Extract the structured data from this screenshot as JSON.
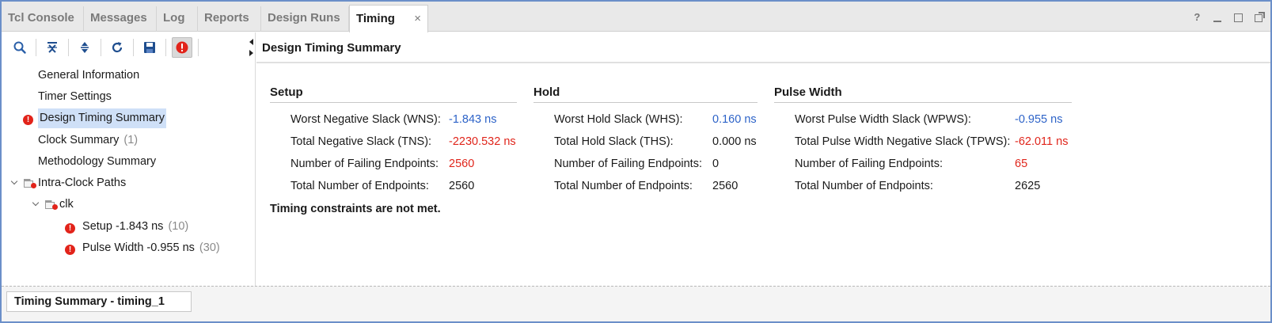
{
  "tabs": [
    {
      "label": "Tcl Console",
      "active": false
    },
    {
      "label": "Messages",
      "active": false
    },
    {
      "label": "Log",
      "active": false
    },
    {
      "label": "Reports",
      "active": false
    },
    {
      "label": "Design Runs",
      "active": false
    },
    {
      "label": "Timing",
      "active": true,
      "close": "×"
    }
  ],
  "window_controls": {
    "help": "?"
  },
  "toolbar": {
    "buttons": [
      "search-icon",
      "collapse-all-icon",
      "expand-all-icon",
      "refresh-icon",
      "save-icon",
      "error-filter-icon"
    ]
  },
  "tree": {
    "items": [
      {
        "label": "General Information"
      },
      {
        "label": "Timer Settings"
      },
      {
        "label": "Design Timing Summary",
        "selected": true,
        "status": "error"
      },
      {
        "label": "Clock Summary",
        "count": "(1)"
      },
      {
        "label": "Methodology Summary"
      },
      {
        "label": "Intra-Clock Paths",
        "expanded": true
      },
      {
        "label": "clk",
        "expanded": true
      },
      {
        "label": "Setup -1.843 ns",
        "count": "(10)",
        "status": "error"
      },
      {
        "label": "Pulse Width -0.955 ns",
        "count": "(30)",
        "status": "error"
      }
    ]
  },
  "main": {
    "title": "Design Timing Summary",
    "setup": {
      "title": "Setup",
      "rows": [
        {
          "label": "Worst Negative Slack (WNS):",
          "value": "-1.843 ns",
          "color": "blue"
        },
        {
          "label": "Total Negative Slack (TNS):",
          "value": "-2230.532 ns",
          "color": "red"
        },
        {
          "label": "Number of Failing Endpoints:",
          "value": "2560",
          "color": "red"
        },
        {
          "label": "Total Number of Endpoints:",
          "value": "2560",
          "color": "black"
        }
      ]
    },
    "hold": {
      "title": "Hold",
      "rows": [
        {
          "label": "Worst Hold Slack (WHS):",
          "value": "0.160 ns",
          "color": "blue"
        },
        {
          "label": "Total Hold Slack (THS):",
          "value": "0.000 ns",
          "color": "black"
        },
        {
          "label": "Number of Failing Endpoints:",
          "value": "0",
          "color": "black"
        },
        {
          "label": "Total Number of Endpoints:",
          "value": "2560",
          "color": "black"
        }
      ]
    },
    "pulse": {
      "title": "Pulse Width",
      "rows": [
        {
          "label": "Worst Pulse Width Slack (WPWS):",
          "value": "-0.955 ns",
          "color": "blue"
        },
        {
          "label": "Total Pulse Width Negative Slack (TPWS):",
          "value": "-62.011 ns",
          "color": "red"
        },
        {
          "label": "Number of Failing Endpoints:",
          "value": "65",
          "color": "red"
        },
        {
          "label": "Total Number of Endpoints:",
          "value": "2625",
          "color": "black"
        }
      ]
    },
    "warning": "Timing constraints are not met."
  },
  "bottom_tab": {
    "label": "Timing Summary - timing_1"
  },
  "colors": {
    "accent_blue": "#2d63c8",
    "error_red": "#e0251b",
    "selection": "#cfe0f7",
    "border": "#6b8fc9"
  }
}
